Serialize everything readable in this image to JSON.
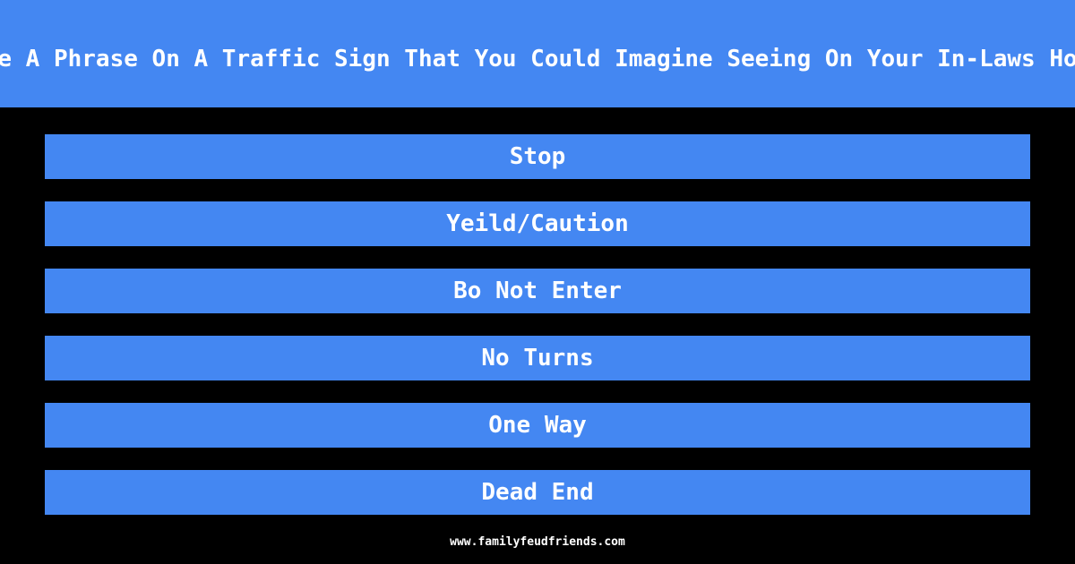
{
  "question": "Name A Phrase On A Traffic Sign That You Could Imagine Seeing On Your In-Laws House",
  "answers": [
    "Stop",
    "Yeild/Caution",
    "Bo Not Enter",
    "No Turns",
    "One Way",
    "Dead End"
  ],
  "footer": "www.familyfeudfriends.com",
  "colors": {
    "accent": "#4487f2",
    "background": "#000000",
    "text": "#ffffff"
  }
}
